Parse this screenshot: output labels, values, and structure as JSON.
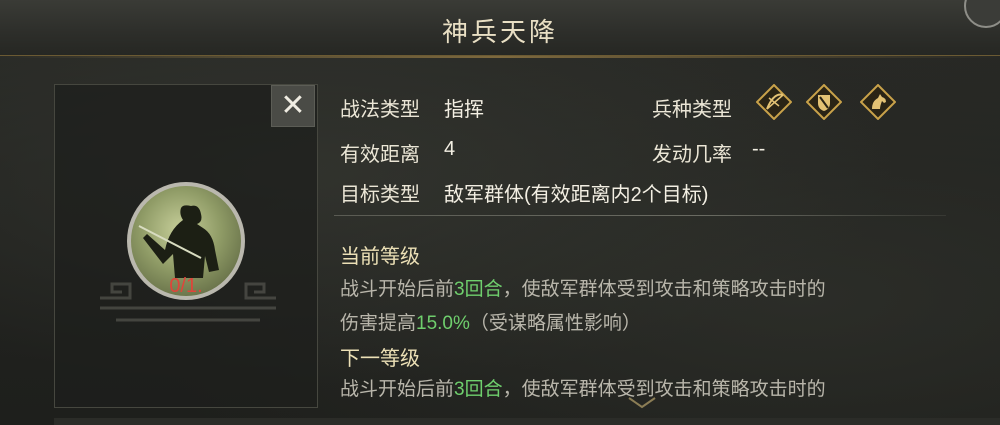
{
  "header": {
    "title": "神兵天降"
  },
  "skill_card": {
    "level_text": "0/1.",
    "close_label": "✕"
  },
  "info": {
    "tactic_type_label": "战法类型",
    "tactic_type_value": "指挥",
    "range_label": "有效距离",
    "range_value": "4",
    "target_label": "目标类型",
    "target_value": "敌军群体(有效距离内2个目标)",
    "troop_label": "兵种类型",
    "troop_icons": [
      "archer-icon",
      "shield-icon",
      "cavalry-icon"
    ],
    "trigger_label": "发动几率",
    "trigger_value": "--"
  },
  "current_level": {
    "title": "当前等级",
    "line1_pre": "战斗开始后前",
    "line1_hl": "3回合",
    "line1_post": "，使敌军群体受到攻击和策略攻击时的",
    "line2_pre": "伤害提高",
    "line2_hl": "15.0%",
    "line2_post": "（受谋略属性影响）"
  },
  "next_level": {
    "title": "下一等级",
    "line1_pre": "战斗开始后前",
    "line1_hl": "3回合",
    "line1_post": "，使敌军群体受到攻击和策略攻击时的"
  },
  "colors": {
    "highlight": "#6fcf6d",
    "level_red": "#e0443a",
    "gold": "#c9a24a"
  }
}
